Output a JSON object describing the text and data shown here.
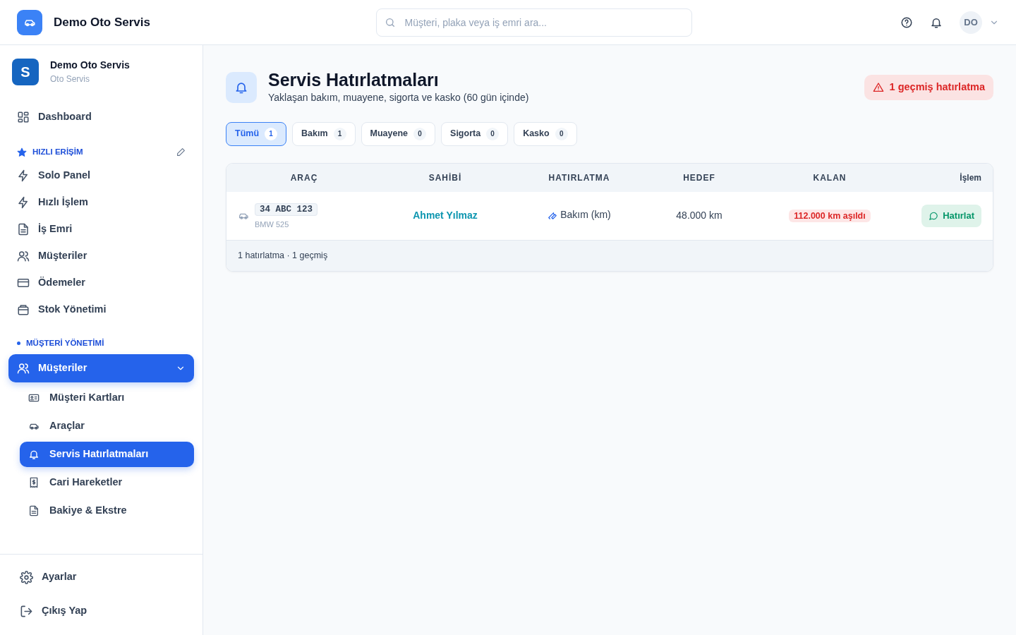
{
  "header": {
    "brand": "Demo Oto Servis",
    "search": {
      "placeholder": "Müşteri, plaka veya iş emri ara..."
    },
    "avatar": "DO"
  },
  "sidebar": {
    "profile": {
      "initial": "S",
      "name": "Demo Oto Servis",
      "subtitle": "Oto Servis"
    },
    "dashboard": {
      "label": "Dashboard",
      "selected": false
    },
    "sections": [
      {
        "kind": "quick",
        "title": "HIZLI ERİŞİM",
        "items": [
          {
            "label": "Solo Panel",
            "selected": false
          },
          {
            "label": "Hızlı İşlem",
            "selected": false
          },
          {
            "label": "İş Emri",
            "selected": false
          },
          {
            "label": "Müşteriler",
            "selected": false
          },
          {
            "label": "Ödemeler",
            "selected": false
          },
          {
            "label": "Stok Yönetimi",
            "selected": false
          }
        ]
      },
      {
        "kind": "dot",
        "title": "MÜŞTERİ YÖNETİMİ",
        "items": [
          {
            "label": "Müşteriler",
            "selected": true,
            "expanded": true,
            "children": [
              {
                "label": "Müşteri Kartları",
                "selected": false
              },
              {
                "label": "Araçlar",
                "selected": false
              },
              {
                "label": "Servis Hatırlatmaları",
                "selected": true
              },
              {
                "label": "Cari Hareketler",
                "selected": false
              },
              {
                "label": "Bakiye & Ekstre",
                "selected": false
              }
            ]
          }
        ]
      }
    ],
    "footer": [
      {
        "label": "Ayarlar"
      },
      {
        "label": "Çıkış Yap"
      }
    ]
  },
  "page": {
    "title": "Servis Hatırlatmaları",
    "subtitle": "Yaklaşan bakım, muayene, sigorta ve kasko (60 gün içinde)",
    "alert": "1 geçmiş hatırlatma"
  },
  "filters": [
    {
      "label": "Tümü",
      "count": "1",
      "selected": true
    },
    {
      "label": "Bakım",
      "count": "1",
      "selected": false
    },
    {
      "label": "Muayene",
      "count": "0",
      "selected": false
    },
    {
      "label": "Sigorta",
      "count": "0",
      "selected": false
    },
    {
      "label": "Kasko",
      "count": "0",
      "selected": false
    }
  ],
  "table": {
    "columns": [
      "ARAÇ",
      "SAHİBİ",
      "HATIRLATMA",
      "HEDEF",
      "KALAN",
      "İşlem"
    ],
    "rows": [
      {
        "plate": "34 ABC 123",
        "model": "BMW 525",
        "owner": "Ahmet Yılmaz",
        "reminder": "Bakım (km)",
        "target": "48.000 km",
        "remaining": "112.000 km aşıldı",
        "overdue": true,
        "action": "Hatırlat"
      }
    ],
    "footer": "1 hatırlatma · 1 geçmiş"
  }
}
